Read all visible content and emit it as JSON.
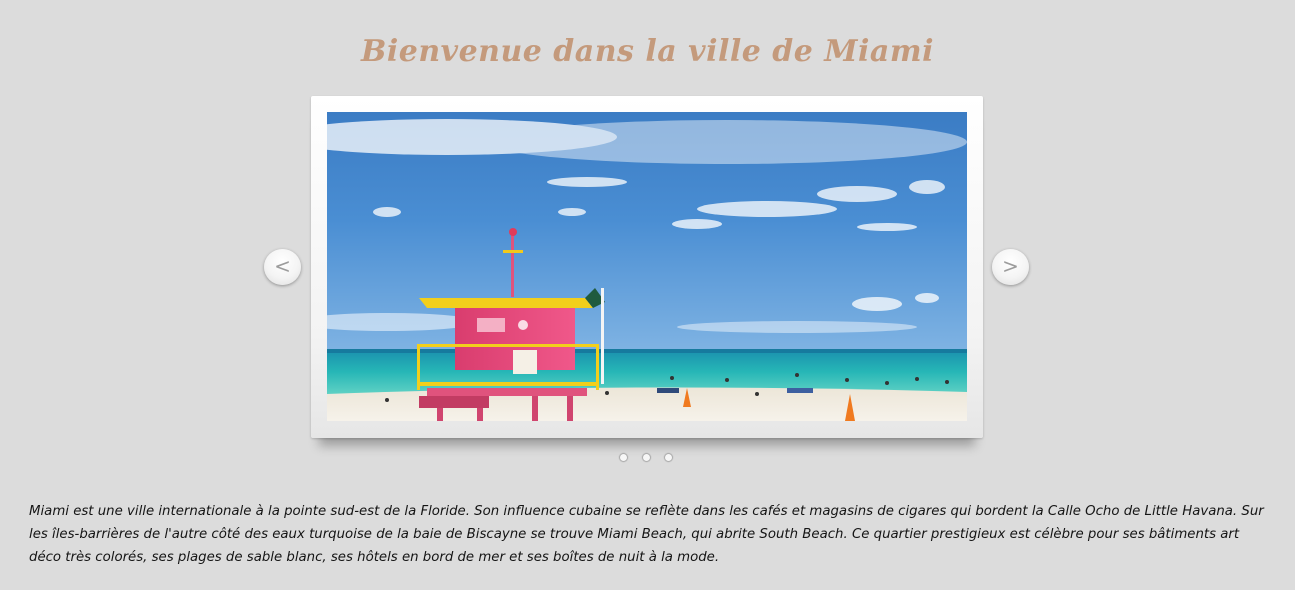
{
  "header": {
    "title": "Bienvenue dans la ville de Miami"
  },
  "slider": {
    "prev_label": "<",
    "next_label": ">",
    "slide_count": 3,
    "active_slide": 1
  },
  "content": {
    "description": "Miami est une ville internationale à la pointe sud-est de la Floride. Son influence cubaine se reflète dans les cafés et magasins de cigares qui bordent la Calle Ocho de Little Havana. Sur les îles-barrières de l'autre côté des eaux turquoise de la baie de Biscayne se trouve Miami Beach, qui abrite South Beach. Ce quartier prestigieux est célèbre pour ses bâtiments art déco très colorés, ses plages de sable blanc, ses hôtels en bord de mer et ses boîtes de nuit à la mode."
  },
  "colors": {
    "background": "#dcdcdc",
    "title": "#c49a7c",
    "text": "#151515"
  }
}
